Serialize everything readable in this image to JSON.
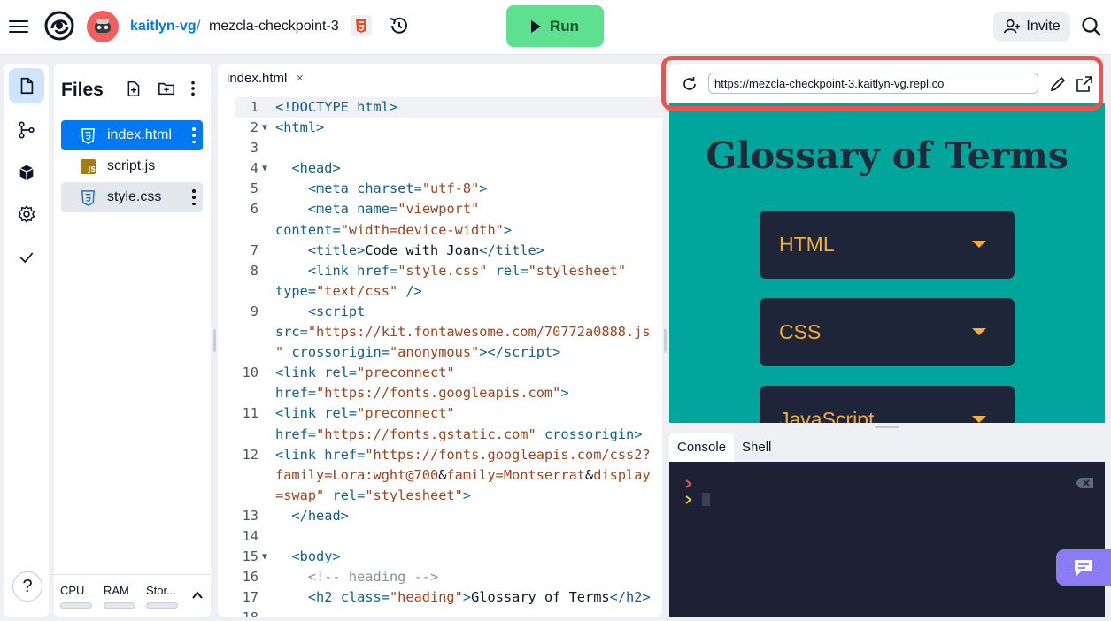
{
  "header": {
    "owner": "kaitlyn-vg",
    "separator": "/",
    "repl_name": "mezcla-checkpoint-3",
    "run_label": "Run",
    "invite_label": "Invite"
  },
  "files_pane": {
    "title": "Files",
    "files": [
      {
        "name": "index.html",
        "icon": "html-file-icon"
      },
      {
        "name": "script.js",
        "icon": "js-file-icon"
      },
      {
        "name": "style.css",
        "icon": "css-file-icon"
      }
    ],
    "resources": {
      "cpu": "CPU",
      "ram": "RAM",
      "storage": "Stor..."
    },
    "help_label": "?"
  },
  "editor": {
    "tab_label": "index.html",
    "tab_close": "×"
  },
  "preview": {
    "url": "https://mezcla-checkpoint-3.kaitlyn-vg.repl.co",
    "heading": "Glossary of Terms",
    "items": [
      "HTML",
      "CSS",
      "JavaScript"
    ]
  },
  "console": {
    "tabs": [
      "Console",
      "Shell"
    ]
  },
  "colors": {
    "accent": "#0079f2",
    "run": "#5ee090",
    "preview_bg": "#00a59b",
    "accordion": "#1e2539",
    "accordion_text": "#f6ad34",
    "highlight": "#ef5350"
  }
}
